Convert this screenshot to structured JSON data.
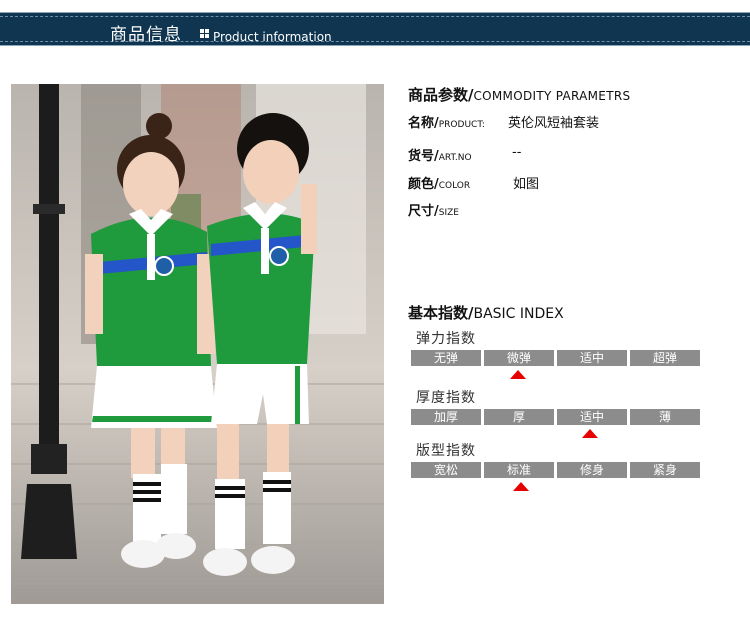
{
  "header": {
    "title": "商品信息",
    "subtitle": "Product information"
  },
  "params": {
    "title_cn": "商品参数/",
    "title_en": "COMMODITY PARAMETRS",
    "rows": [
      {
        "label_cn": "名称/",
        "label_en": "PRODUCT:",
        "value": "英伦风短袖套装"
      },
      {
        "label_cn": "货号/",
        "label_en": "ART.NO",
        "value": "--"
      },
      {
        "label_cn": "颜色/",
        "label_en": "COLOR",
        "value": "如图"
      },
      {
        "label_cn": "尺寸/",
        "label_en": "SIZE",
        "value": ""
      }
    ]
  },
  "index": {
    "title_cn": "基本指数/",
    "title_en": "BASIC INDEX",
    "groups": [
      {
        "title": "弹力指数",
        "options": [
          "无弹",
          "微弹",
          "适中",
          "超弹"
        ],
        "selected": 1
      },
      {
        "title": "厚度指数",
        "options": [
          "加厚",
          "厚",
          "适中",
          "薄"
        ],
        "selected": 2
      },
      {
        "title": "版型指数",
        "options": [
          "宽松",
          "标准",
          "修身",
          "紧身"
        ],
        "selected": 1
      }
    ]
  },
  "colors": {
    "header_bg": "#0f3550",
    "scale_cell": "#8c8c8c",
    "marker": "#e60000",
    "shirt_green": "#1f9a3c",
    "stripe_blue": "#2456c9"
  }
}
